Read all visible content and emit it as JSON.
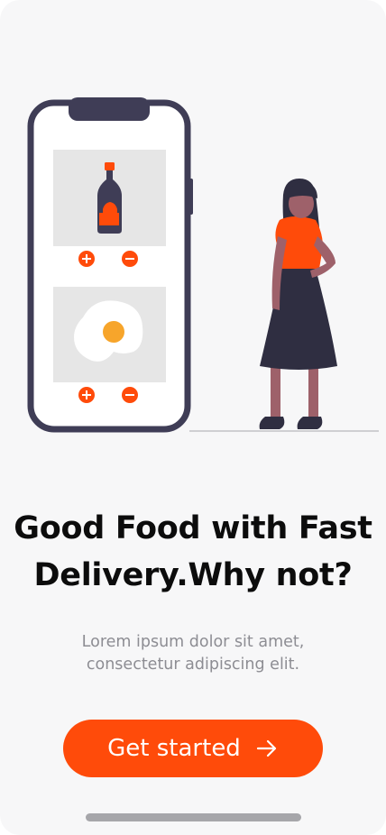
{
  "onboarding": {
    "title_line1": "Good Food with Fast",
    "title_line2": "Delivery.Why not?",
    "subtitle_line1": "Lorem ipsum dolor sit amet,",
    "subtitle_line2": "consectetur adipiscing elit.",
    "cta_label": "Get started",
    "cta_icon": "arrow-right-icon"
  },
  "colors": {
    "accent": "#ff4b0a",
    "background": "#f7f7f8",
    "text": "#0c0c0c",
    "muted_text": "#8d8d93",
    "dark_navy": "#3f3d56"
  },
  "illustration": {
    "items": [
      {
        "name": "ketchup-bottle",
        "icons": [
          "plus-icon",
          "minus-icon"
        ]
      },
      {
        "name": "fried-egg",
        "icons": [
          "plus-icon",
          "minus-icon"
        ]
      }
    ]
  }
}
